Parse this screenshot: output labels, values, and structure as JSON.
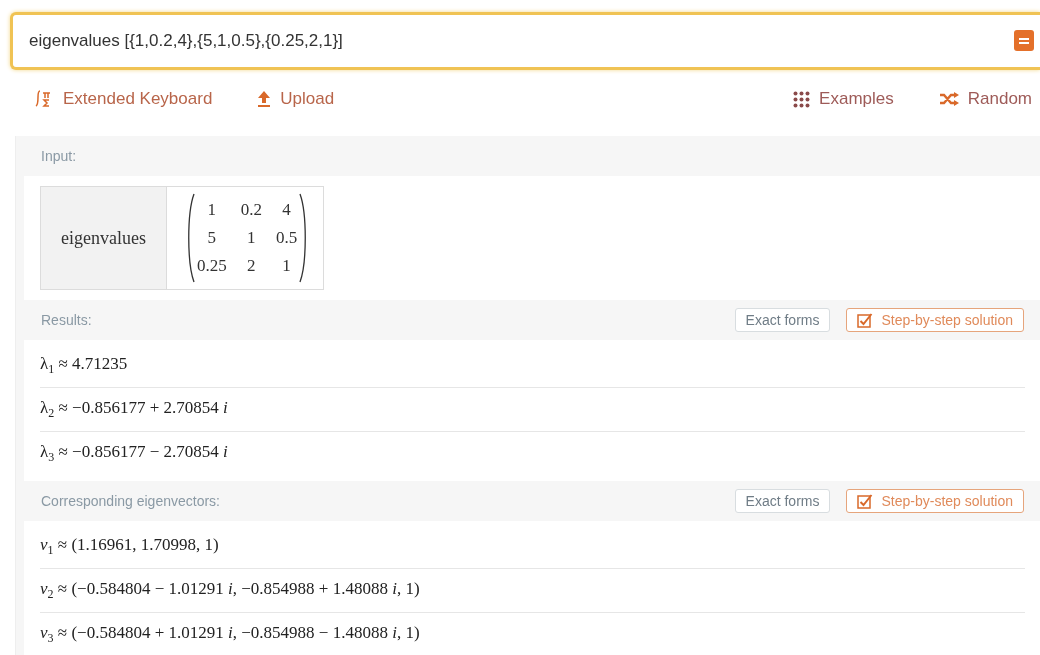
{
  "query": {
    "value": "eigenvalues [{1,0.2,4},{5,1,0.5},{0.25,2,1}]"
  },
  "toolbar": {
    "left": [
      {
        "label": "Extended Keyboard",
        "kind": "keyboard"
      },
      {
        "label": "Upload",
        "kind": "upload"
      }
    ],
    "right": [
      {
        "label": "Examples",
        "kind": "grid"
      },
      {
        "label": "Random",
        "kind": "shuffle"
      }
    ]
  },
  "pods": [
    {
      "title": "Input:",
      "kind": "input",
      "function": "eigenvalues",
      "matrix": [
        [
          "1",
          "0.2",
          "4"
        ],
        [
          "5",
          "1",
          "0.5"
        ],
        [
          "0.25",
          "2",
          "1"
        ]
      ]
    },
    {
      "title": "Results:",
      "kind": "list",
      "buttons": [
        {
          "label": "Exact forms",
          "kind": "plain"
        },
        {
          "label": "Step-by-step solution",
          "kind": "step"
        }
      ],
      "rows": [
        "λ$_{1}$ ≈ 4.71235",
        "λ$_{2}$ ≈ −0.856177 + 2.70854 *i*",
        "λ$_{3}$ ≈ −0.856177 − 2.70854 *i*"
      ]
    },
    {
      "title": "Corresponding eigenvectors:",
      "kind": "list",
      "buttons": [
        {
          "label": "Exact forms",
          "kind": "plain"
        },
        {
          "label": "Step-by-step solution",
          "kind": "step"
        }
      ],
      "rows": [
        "*v*$_{1}$ ≈ (1.16961, 1.70998, 1)",
        "*v*$_{2}$ ≈ (−0.584804 − 1.01291 *i*, −0.854988 + 1.48088 *i*, 1)",
        "*v*$_{3}$ ≈ (−0.584804 + 1.01291 *i*, −0.854988 − 1.48088 *i*, 1)"
      ]
    }
  ]
}
